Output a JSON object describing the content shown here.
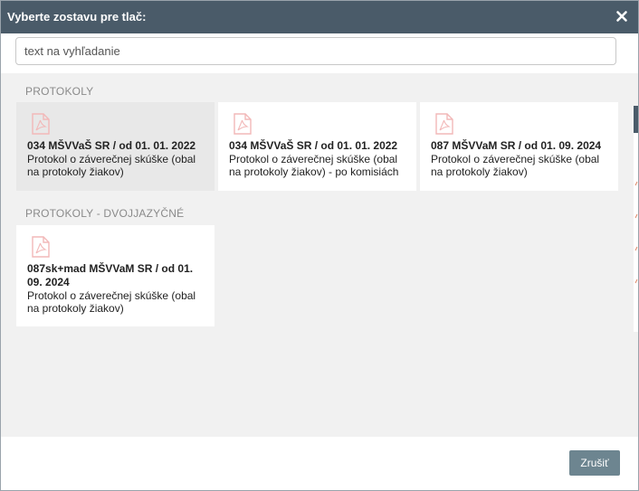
{
  "dialog": {
    "title": "Vyberte zostavu pre tlač:",
    "close_icon": "close-icon"
  },
  "search": {
    "placeholder": "text na vyhľadanie",
    "value": ""
  },
  "sections": [
    {
      "title": "PROTOKOLY",
      "cards": [
        {
          "code": "034 MŠVVaŠ SR / od 01. 01. 2022",
          "description": "Protokol o záverečnej skúške (obal na protokoly žiakov)",
          "icon": "pdf-icon",
          "selected": true
        },
        {
          "code": "034 MŠVVaŠ SR / od 01. 01. 2022",
          "description": "Protokol o záverečnej skúške (obal na protokoly žiakov) - po komisiách",
          "icon": "pdf-icon",
          "selected": false
        },
        {
          "code": "087 MŠVVaM SR / od 01. 09. 2024",
          "description": "Protokol o záverečnej skúške (obal na protokoly žiakov)",
          "icon": "pdf-icon",
          "selected": false
        }
      ]
    },
    {
      "title": "PROTOKOLY - DVOJJAZYČNÉ",
      "cards": [
        {
          "code": "087sk+mad MŠVVaM SR / od 01. 09. 2024",
          "description": "Protokol o záverečnej skúške (obal na protokoly žiakov)",
          "icon": "pdf-icon",
          "selected": false
        }
      ]
    }
  ],
  "footer": {
    "cancel_label": "Zrušiť"
  },
  "colors": {
    "titlebar": "#4a5b69",
    "pdf_icon": "#f2b8b8",
    "cancel_button": "#6d8590",
    "selected_card": "#e8e8e8"
  }
}
